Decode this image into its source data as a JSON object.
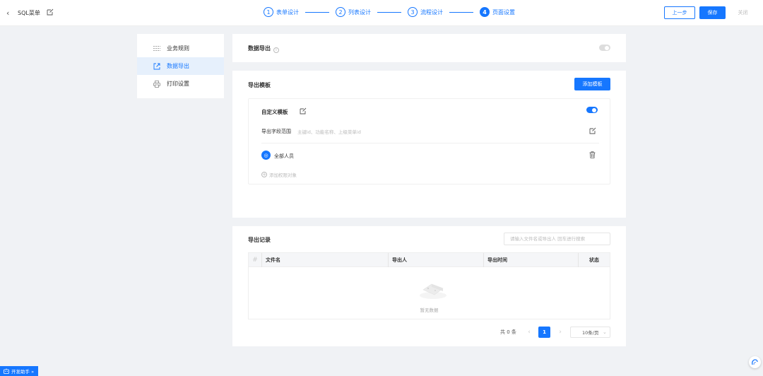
{
  "header": {
    "back_icon": "chevron-left-icon",
    "title": "SQL菜单",
    "steps": [
      {
        "num": "1",
        "label": "表单设计"
      },
      {
        "num": "2",
        "label": "列表设计"
      },
      {
        "num": "3",
        "label": "流程设计"
      },
      {
        "num": "4",
        "label": "页面设置"
      }
    ],
    "active_step": 4,
    "buttons": {
      "prev": "上一步",
      "save": "保存",
      "close": "关闭"
    },
    "accent": "#1677ff"
  },
  "sidebar": {
    "items": [
      {
        "label": "业务规则",
        "icon": "sliders-icon"
      },
      {
        "label": "数据导出",
        "icon": "export-icon",
        "active": true
      },
      {
        "label": "打印设置",
        "icon": "printer-icon"
      }
    ]
  },
  "export_toggle": {
    "title": "数据导出",
    "enabled": false
  },
  "templates": {
    "title": "导出模板",
    "add_button": "添加模板",
    "template": {
      "name": "自定义模板",
      "enabled": true,
      "range_label": "导出字段范围",
      "range_placeholder": "主键id、功能名称、上级菜单id",
      "user": "全部人员",
      "add_permission": "添加权限对象"
    }
  },
  "records": {
    "title": "导出记录",
    "search_placeholder": "请输入文件名或导出人 回车进行搜索",
    "columns": [
      "#",
      "文件名",
      "导出人",
      "导出时间",
      "状态"
    ],
    "empty_text": "暂无数据",
    "pagination": {
      "total": "共 0 条",
      "current": "1",
      "page_size": "10条/页"
    }
  },
  "footer": {
    "dev_assistant": "开发助手 »"
  }
}
